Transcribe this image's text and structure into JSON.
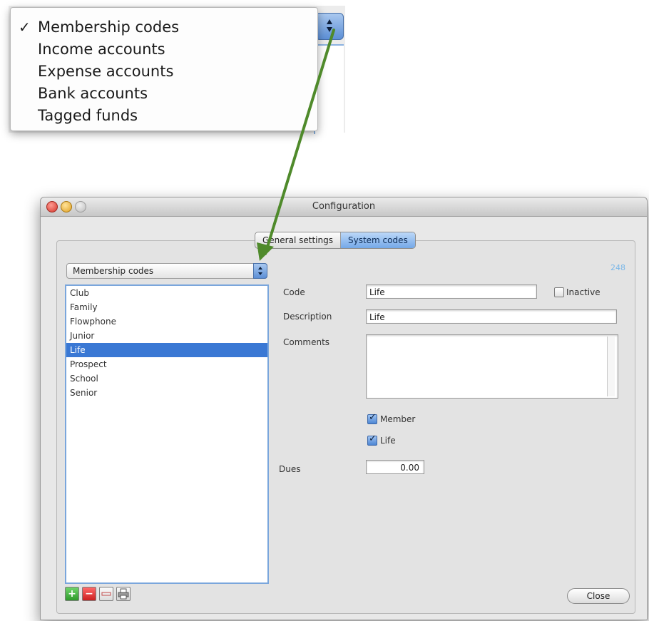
{
  "dropdown": {
    "items": [
      {
        "label": "Membership codes",
        "checked": true
      },
      {
        "label": "Income accounts",
        "checked": false
      },
      {
        "label": "Expense accounts",
        "checked": false
      },
      {
        "label": "Bank accounts",
        "checked": false
      },
      {
        "label": "Tagged funds",
        "checked": false
      }
    ],
    "check_glyph": "✓"
  },
  "window": {
    "title": "Configuration",
    "tabs": [
      {
        "label": "General settings",
        "active": false
      },
      {
        "label": "System codes",
        "active": true
      }
    ],
    "record_count": "248",
    "category_select": {
      "value": "Membership codes"
    },
    "code_list": {
      "items": [
        "Club",
        "Family",
        "Flowphone",
        "Junior",
        "Life",
        "Prospect",
        "School",
        "Senior"
      ],
      "selected": "Life"
    },
    "form": {
      "code_label": "Code",
      "code_value": "Life",
      "inactive_label": "Inactive",
      "inactive_checked": false,
      "description_label": "Description",
      "description_value": "Life",
      "comments_label": "Comments",
      "comments_value": "",
      "member_label": "Member",
      "member_checked": true,
      "life_label": "Life",
      "life_checked": true,
      "dues_label": "Dues",
      "dues_value": "0.00"
    },
    "close_label": "Close"
  },
  "colors": {
    "accent": "#3a78d4",
    "arrow": "#4f8a2b"
  },
  "icons": {
    "add": "+",
    "remove": "−",
    "check": "✓"
  }
}
